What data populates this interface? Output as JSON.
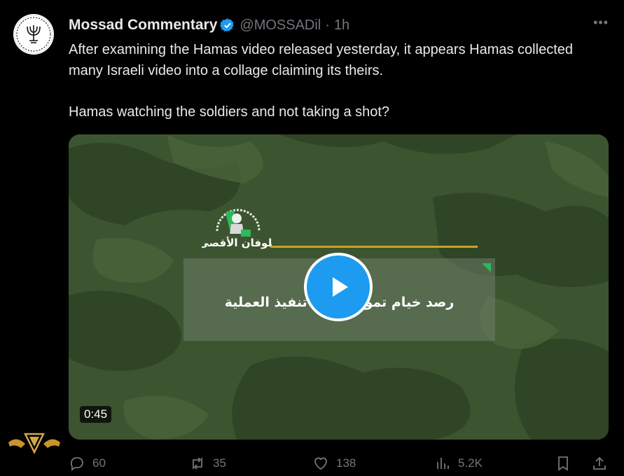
{
  "tweet": {
    "author_name": "Mossad Commentary",
    "handle": "@MOSSADil",
    "separator": "·",
    "time": "1h",
    "more": "•••",
    "text_p1": "After examining the Hamas video released yesterday, it appears Hamas collected many Israeli video into a collage claiming its theirs.",
    "text_p2": "Hamas watching the soldiers and not taking a shot?"
  },
  "video": {
    "caption": "رصد خيام تموضع قبل تنفيذ العملية",
    "duration": "0:45",
    "emblem_text": "طوفان الأقصى"
  },
  "actions": {
    "replies": "60",
    "reposts": "35",
    "likes": "138",
    "views": "5.2K"
  },
  "colors": {
    "accent": "#1d9bf0",
    "muted": "#71767b",
    "background": "#000000"
  },
  "icons": [
    "verified-badge-icon",
    "more-icon",
    "play-icon",
    "reply-icon",
    "repost-icon",
    "like-icon",
    "views-icon",
    "bookmark-icon",
    "share-icon"
  ]
}
